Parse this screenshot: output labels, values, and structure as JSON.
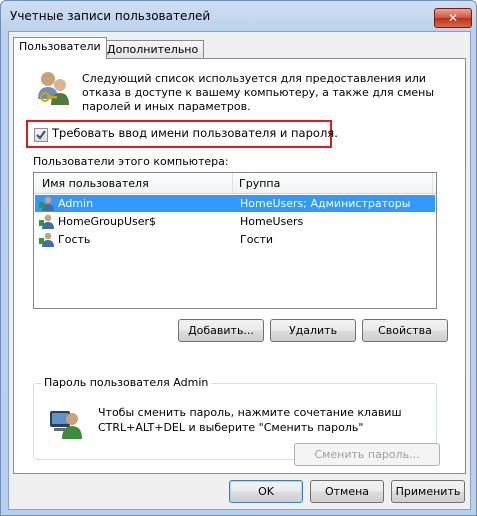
{
  "window": {
    "title": "Учетные записи пользователей",
    "close_label": "✕"
  },
  "tabs": [
    {
      "label": "Пользователи"
    },
    {
      "label": "Дополнительно"
    }
  ],
  "info": {
    "text": "Следующий список используется для предоставления или отказа в доступе к вашему компьютеру, а также для смены паролей и иных параметров."
  },
  "require_login": {
    "label": "Требовать ввод имени пользователя и пароля.",
    "checked": true
  },
  "users_list": {
    "caption": "Пользователи этого компьютера:",
    "columns": [
      "Имя пользователя",
      "Группа"
    ],
    "rows": [
      {
        "name": "Admin",
        "group": "HomeUsers; Администраторы",
        "selected": true
      },
      {
        "name": "HomeGroupUser$",
        "group": "HomeUsers",
        "selected": false
      },
      {
        "name": "Гость",
        "group": "Гости",
        "selected": false
      }
    ]
  },
  "list_buttons": {
    "add": "Добавить...",
    "delete": "Удалить",
    "properties": "Свойства"
  },
  "password_group": {
    "title": "Пароль пользователя Admin",
    "line1": "Чтобы сменить пароль, нажмите сочетание клавиш",
    "line2": "CTRL+ALT+DEL и выберите \"Сменить пароль\"",
    "change_button": "Сменить пароль..."
  },
  "dialog_buttons": {
    "ok": "OK",
    "cancel": "Отмена",
    "apply": "Применить"
  }
}
